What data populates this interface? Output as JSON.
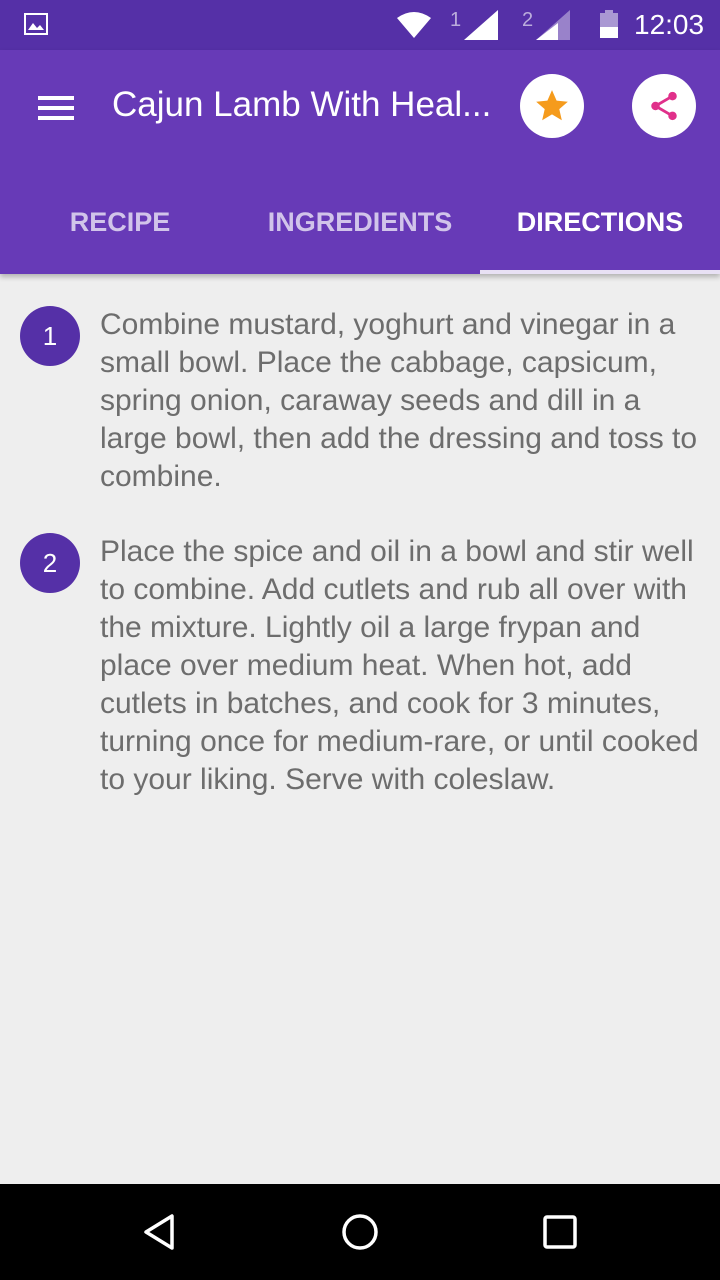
{
  "status_bar": {
    "sim1_label": "1",
    "sim2_label": "2",
    "time": "12:03"
  },
  "app_bar": {
    "title": "Cajun Lamb With Heal...",
    "menu_icon": "hamburger-menu-icon",
    "favorite_icon": "star-icon",
    "share_icon": "share-icon",
    "favorite_color": "#f59b1c",
    "share_color": "#e0308a",
    "background": "#673ab7"
  },
  "tabs": [
    {
      "label": "RECIPE",
      "active": false
    },
    {
      "label": "INGREDIENTS",
      "active": false
    },
    {
      "label": "DIRECTIONS",
      "active": true
    }
  ],
  "directions": [
    {
      "number": "1",
      "text": "Combine mustard, yoghurt and vinegar in a small bowl. Place the cabbage, capsicum, spring onion, caraway seeds and dill in a large bowl, then add the dressing and toss to combine."
    },
    {
      "number": "2",
      "text": "Place the spice and oil in a bowl and stir well to combine. Add cutlets and rub all over with the mixture. Lightly oil a large frypan and place over medium heat. When hot, add cutlets in batches, and cook for 3 minutes, turning once for medium-rare, or until cooked to your liking. Serve with coleslaw."
    }
  ],
  "nav_bar": {
    "back_icon": "back-triangle-icon",
    "home_icon": "home-circle-icon",
    "recents_icon": "recents-square-icon"
  }
}
